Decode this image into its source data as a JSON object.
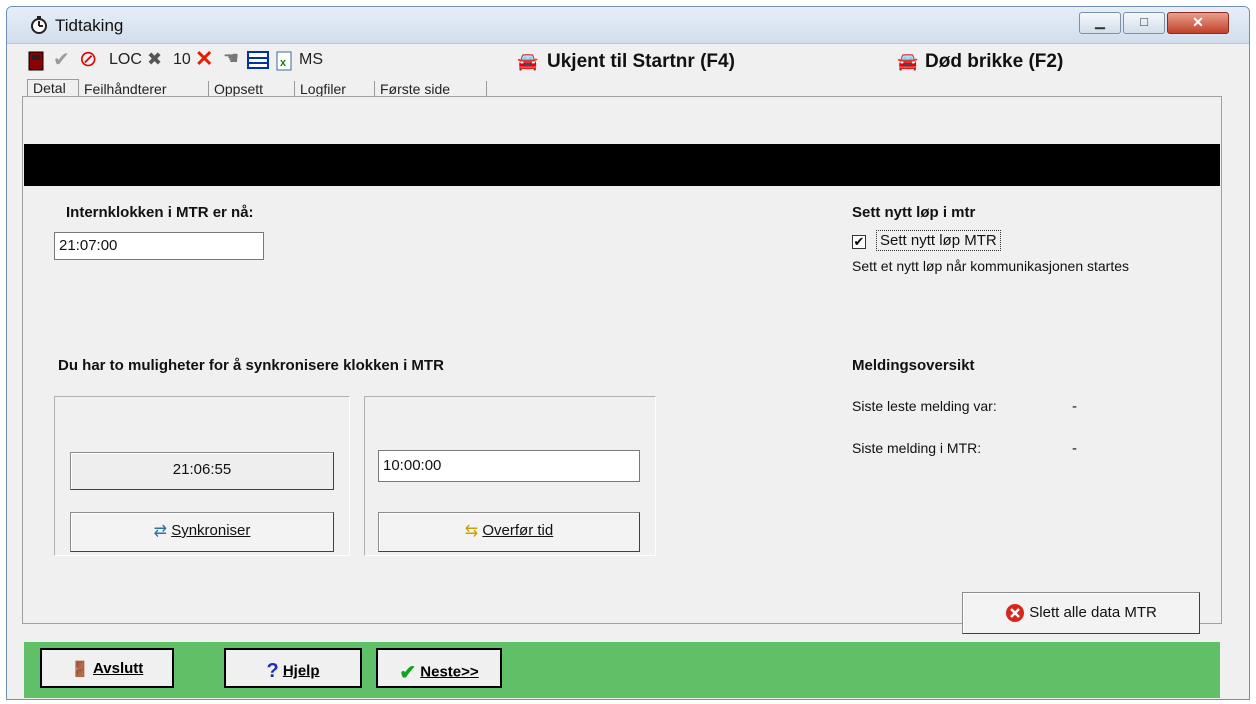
{
  "window": {
    "title": "Tidtaking"
  },
  "toolbar": {
    "loc_label": "LOC",
    "count_label": "10",
    "ms_label": "MS",
    "unknown_button": "Ukjent til Startnr (F4)",
    "dead_chip_button": "Død brikke (F2)"
  },
  "tabs": [
    "Detal",
    "Feilhåndterer",
    "Oppsett",
    "Logfiler",
    "Første side"
  ],
  "main": {
    "internal_clock_label": "Internklokken i MTR er nå:",
    "internal_clock_value": "21:07:00",
    "new_race_heading": "Sett nytt løp i mtr",
    "new_race_checkbox_label": "Sett nytt løp MTR",
    "new_race_checked": true,
    "new_race_description": "Sett et nytt løp når kommunikasjonen startes",
    "sync_heading": "Du har to muligheter for å synkronisere klokken i MTR",
    "sync_time_display": "21:06:55",
    "sync_button": "Synkroniser",
    "transfer_input_value": "10:00:00",
    "transfer_button": "Overfør tid",
    "messages_heading": "Meldingsoversikt",
    "last_read_label": "Siste leste melding var:",
    "last_read_value": "-",
    "last_message_label": "Siste melding i MTR:",
    "last_message_value": "-",
    "delete_all_button": "Slett alle data MTR"
  },
  "footer": {
    "exit_button": "Avslutt",
    "help_button": "Hjelp",
    "next_button": "Neste>>"
  }
}
